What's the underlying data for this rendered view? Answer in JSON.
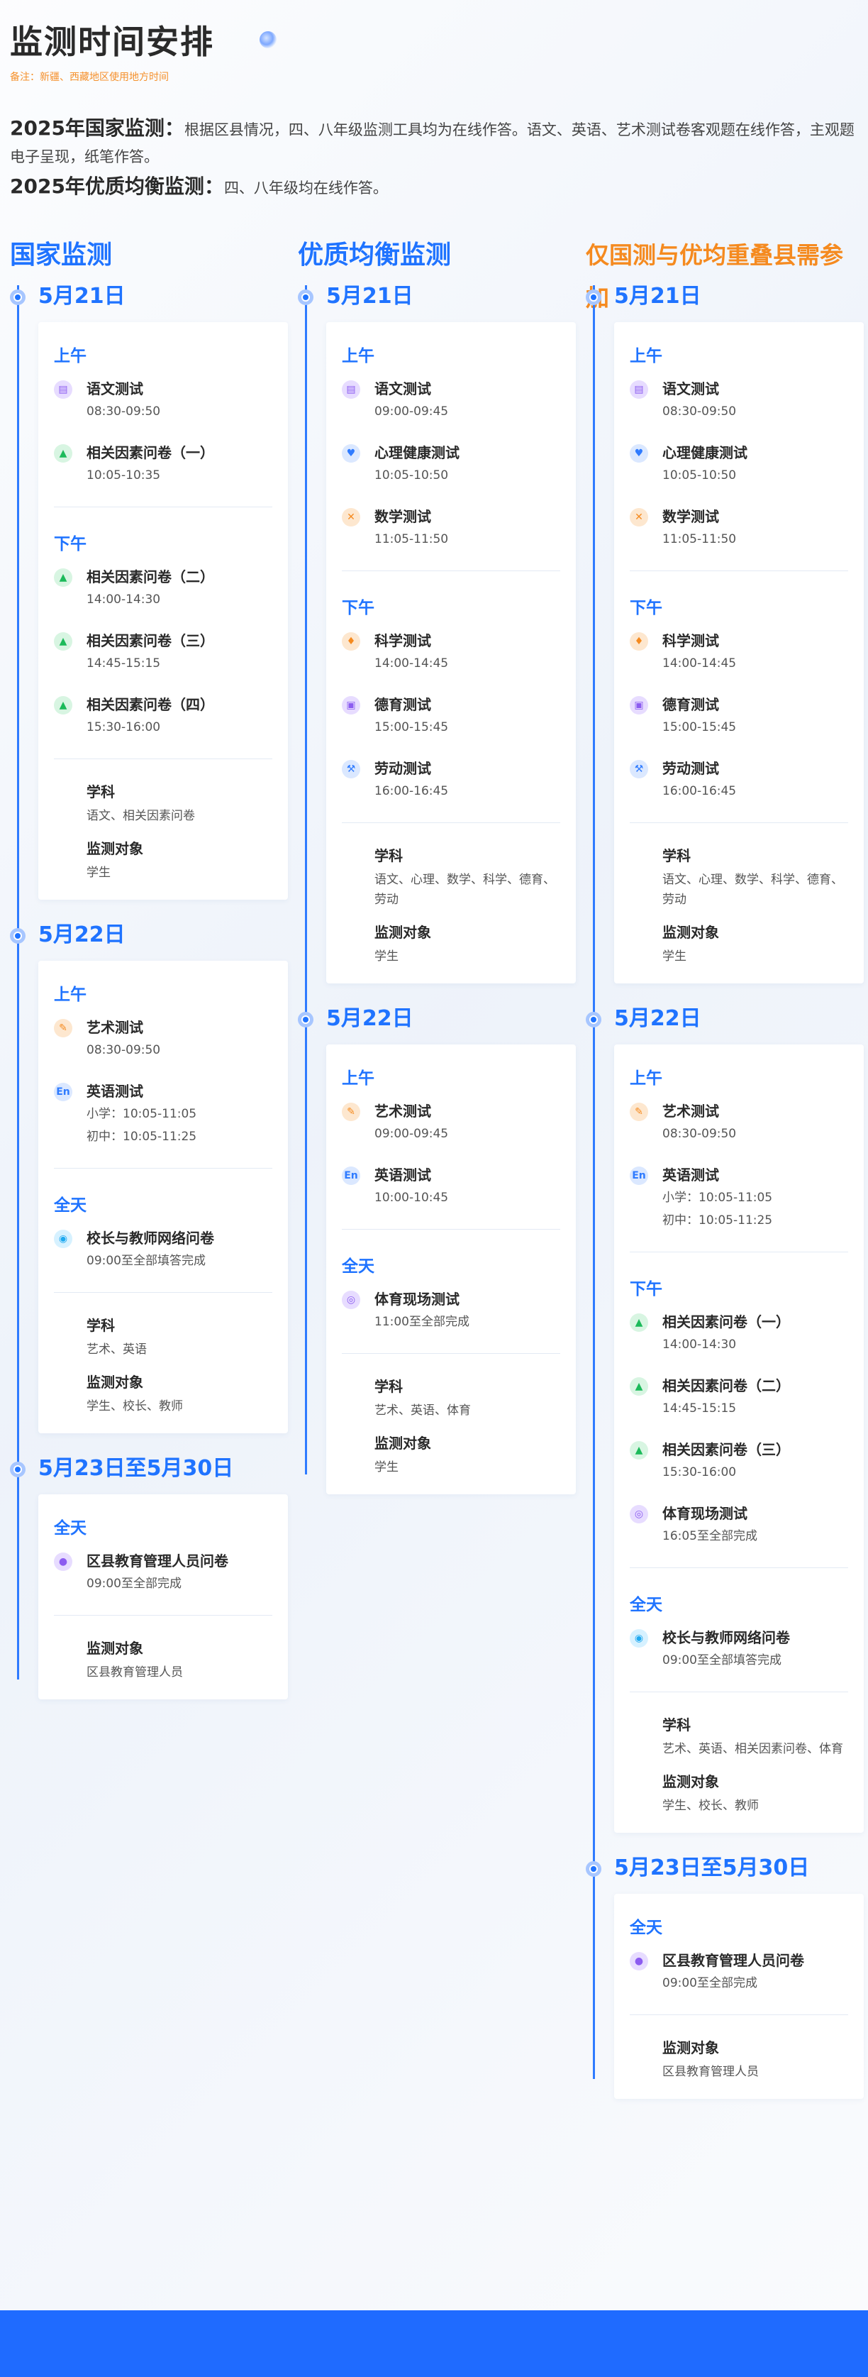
{
  "header": {
    "title": "监测时间安排",
    "remark": "备注：新疆、西藏地区使用地方时间"
  },
  "intro": {
    "national_label": "2025年国家监测：",
    "national_text": "根据区县情况，四、八年级监测工具均为在线作答。语文、英语、艺术测试卷客观题在线作答，主观题电子呈现，纸笔作答。",
    "balanced_label": "2025年优质均衡监测：",
    "balanced_text": "四、八年级均在线作答。"
  },
  "columns": [
    {
      "title": "国家监测",
      "days": [
        {
          "date": "5月21日",
          "sections": [
            {
              "label": "上午",
              "items": [
                {
                  "icon": "book-icon",
                  "name": "语文测试",
                  "time": "08:30-09:50"
                },
                {
                  "icon": "graduation-cap-icon",
                  "name": "相关因素问卷（一）",
                  "time": "10:05-10:35"
                }
              ]
            },
            {
              "label": "下午",
              "items": [
                {
                  "icon": "graduation-cap-icon",
                  "name": "相关因素问卷（二）",
                  "time": "14:00-14:30"
                },
                {
                  "icon": "graduation-cap-icon",
                  "name": "相关因素问卷（三）",
                  "time": "14:45-15:15"
                },
                {
                  "icon": "graduation-cap-icon",
                  "name": "相关因素问卷（四）",
                  "time": "15:30-16:00"
                }
              ]
            }
          ],
          "subject_label": "学科",
          "subject": "语文、相关因素问卷",
          "target_label": "监测对象",
          "target": "学生"
        },
        {
          "date": "5月22日",
          "sections": [
            {
              "label": "上午",
              "items": [
                {
                  "icon": "palette-icon",
                  "name": "艺术测试",
                  "time": "08:30-09:50"
                },
                {
                  "icon": "english-icon",
                  "name": "英语测试",
                  "time": "小学：10:05-11:05",
                  "time2": "初中：10:05-11:25"
                }
              ]
            },
            {
              "label": "全天",
              "items": [
                {
                  "icon": "user-group-icon",
                  "name": "校长与教师网络问卷",
                  "time": "09:00至全部填答完成"
                }
              ]
            }
          ],
          "subject_label": "学科",
          "subject": "艺术、英语",
          "target_label": "监测对象",
          "target": "学生、校长、教师"
        },
        {
          "date": "5月23日至5月30日",
          "sections": [
            {
              "label": "全天",
              "items": [
                {
                  "icon": "person-icon",
                  "name": "区县教育管理人员问卷",
                  "time": "09:00至全部完成"
                }
              ]
            }
          ],
          "target_label": "监测对象",
          "target": "区县教育管理人员"
        }
      ]
    },
    {
      "title": "优质均衡监测",
      "days": [
        {
          "date": "5月21日",
          "sections": [
            {
              "label": "上午",
              "items": [
                {
                  "icon": "book-icon",
                  "name": "语文测试",
                  "time": "09:00-09:45"
                },
                {
                  "icon": "heart-hand-icon",
                  "name": "心理健康测试",
                  "time": "10:05-10:50"
                },
                {
                  "icon": "math-icon",
                  "name": "数学测试",
                  "time": "11:05-11:50"
                }
              ]
            },
            {
              "label": "下午",
              "items": [
                {
                  "icon": "flask-icon",
                  "name": "科学测试",
                  "time": "14:00-14:45"
                },
                {
                  "icon": "clipboard-icon",
                  "name": "德育测试",
                  "time": "15:00-15:45"
                },
                {
                  "icon": "labor-icon",
                  "name": "劳动测试",
                  "time": "16:00-16:45"
                }
              ]
            }
          ],
          "subject_label": "学科",
          "subject": "语文、心理、数学、科学、德育、劳动",
          "target_label": "监测对象",
          "target": "学生"
        },
        {
          "date": "5月22日",
          "sections": [
            {
              "label": "上午",
              "items": [
                {
                  "icon": "palette-icon",
                  "name": "艺术测试",
                  "time": "09:00-09:45"
                },
                {
                  "icon": "english-icon",
                  "name": "英语测试",
                  "time": "10:00-10:45"
                }
              ]
            },
            {
              "label": "全天",
              "items": [
                {
                  "icon": "sport-icon",
                  "name": "体育现场测试",
                  "time": "11:00至全部完成"
                }
              ]
            }
          ],
          "subject_label": "学科",
          "subject": "艺术、英语、体育",
          "target_label": "监测对象",
          "target": "学生"
        }
      ]
    },
    {
      "title": "仅国测与优均重叠县需参加",
      "days": [
        {
          "date": "5月21日",
          "sections": [
            {
              "label": "上午",
              "items": [
                {
                  "icon": "book-icon",
                  "name": "语文测试",
                  "time": "08:30-09:50"
                },
                {
                  "icon": "heart-hand-icon",
                  "name": "心理健康测试",
                  "time": "10:05-10:50"
                },
                {
                  "icon": "math-icon",
                  "name": "数学测试",
                  "time": "11:05-11:50"
                }
              ]
            },
            {
              "label": "下午",
              "items": [
                {
                  "icon": "flask-icon",
                  "name": "科学测试",
                  "time": "14:00-14:45"
                },
                {
                  "icon": "clipboard-icon",
                  "name": "德育测试",
                  "time": "15:00-15:45"
                },
                {
                  "icon": "labor-icon",
                  "name": "劳动测试",
                  "time": "16:00-16:45"
                }
              ]
            }
          ],
          "subject_label": "学科",
          "subject": "语文、心理、数学、科学、德育、劳动",
          "target_label": "监测对象",
          "target": "学生"
        },
        {
          "date": "5月22日",
          "sections": [
            {
              "label": "上午",
              "items": [
                {
                  "icon": "palette-icon",
                  "name": "艺术测试",
                  "time": "08:30-09:50"
                },
                {
                  "icon": "english-icon",
                  "name": "英语测试",
                  "time": "小学：10:05-11:05",
                  "time2": "初中：10:05-11:25"
                }
              ]
            },
            {
              "label": "下午",
              "items": [
                {
                  "icon": "graduation-cap-icon",
                  "name": "相关因素问卷（一）",
                  "time": "14:00-14:30"
                },
                {
                  "icon": "graduation-cap-icon",
                  "name": "相关因素问卷（二）",
                  "time": "14:45-15:15"
                },
                {
                  "icon": "graduation-cap-icon",
                  "name": "相关因素问卷（三）",
                  "time": "15:30-16:00"
                },
                {
                  "icon": "sport-icon",
                  "name": "体育现场测试",
                  "time": "16:05至全部完成"
                }
              ]
            },
            {
              "label": "全天",
              "items": [
                {
                  "icon": "user-group-icon",
                  "name": "校长与教师网络问卷",
                  "time": "09:00至全部填答完成"
                }
              ]
            }
          ],
          "subject_label": "学科",
          "subject": "艺术、英语、相关因素问卷、体育",
          "target_label": "监测对象",
          "target": "学生、校长、教师"
        },
        {
          "date": "5月23日至5月30日",
          "sections": [
            {
              "label": "全天",
              "items": [
                {
                  "icon": "person-icon",
                  "name": "区县教育管理人员问卷",
                  "time": "09:00至全部完成"
                }
              ]
            }
          ],
          "target_label": "监测对象",
          "target": "区县教育管理人员"
        }
      ]
    }
  ],
  "colors": {
    "accent": "#1f73ff",
    "orange": "#f58a1f",
    "footer": "#1f6bff"
  }
}
